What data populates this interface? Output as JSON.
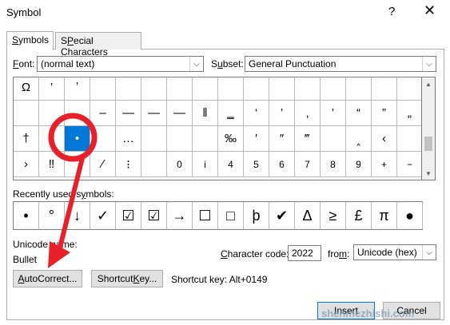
{
  "window": {
    "title": "Symbol",
    "help_glyph": "?",
    "close_glyph": "✕"
  },
  "tabs": [
    {
      "label_pre": "",
      "label_u": "S",
      "label_post": "ymbols",
      "active": true
    },
    {
      "label_pre": "",
      "label_u": "P",
      "label_post": "special Characters",
      "active": false
    }
  ],
  "font": {
    "label_u": "F",
    "label_post": "ont:",
    "value": "(normal text)"
  },
  "subset": {
    "label_u": "u",
    "label_pre": "S",
    "label_post": "bset:",
    "value": "General Punctuation"
  },
  "grid": {
    "rows": [
      [
        "Ω",
        "’",
        "‚",
        "",
        "",
        "",
        "",
        "",
        "",
        "",
        "",
        "",
        "",
        "",
        "",
        ""
      ],
      [
        "",
        "",
        "",
        "–",
        "—",
        "—",
        "―",
        "‖",
        "‗",
        "‘",
        "’",
        "‚",
        "‛",
        "“",
        "”",
        "„"
      ],
      [
        "†",
        "‡",
        "•",
        "‣",
        "․",
        "‥",
        "…",
        "‧",
        "‰",
        "′",
        "″",
        "‴",
        "‵",
        "‸",
        "‹",
        "›"
      ],
      [
        "›",
        "‼",
        "‾",
        "",
        "⁄",
        "⁝",
        "⁰",
        "ⁱ",
        "⁴",
        "⁵",
        "⁶",
        "⁷",
        "⁸",
        "⁹",
        "⁺",
        "⁻"
      ]
    ],
    "display_rows": [
      [
        "Ω",
        "’",
        "ʼ",
        "",
        "",
        "",
        "",
        "",
        "",
        "",
        "",
        "",
        "",
        "",
        "",
        ""
      ],
      [
        "",
        "",
        "",
        "–",
        "—",
        "―",
        "―",
        "‖",
        "‗",
        "‘",
        "’",
        "‚",
        "‛",
        "“",
        "”",
        "„"
      ],
      [
        "†",
        "‡",
        "•",
        "",
        "…",
        "",
        "",
        "",
        "‰",
        "′",
        "″",
        "‴",
        "‵",
        "‸",
        "‹",
        ""
      ],
      [
        "›",
        "‼",
        "‽",
        "⁄",
        "⁝",
        "",
        "⁰",
        "ⁱ",
        "4",
        "5",
        "6",
        "7",
        "8",
        "9",
        "+",
        "−"
      ]
    ],
    "selected": {
      "row": 2,
      "col": 2
    }
  },
  "grid_visible": [
    [
      "Ω",
      "’",
      "ʼ",
      "",
      "",
      "",
      "",
      "",
      "",
      "",
      "",
      "",
      "",
      "",
      "",
      ""
    ],
    [
      "",
      "",
      "",
      "–",
      "—",
      "—",
      "—",
      "‖",
      "‗",
      "‘",
      "’",
      "‚",
      "‛",
      "“",
      "”",
      "„"
    ],
    [
      "†",
      "‡",
      "•",
      "",
      "…",
      "",
      "",
      "",
      "‰",
      "′",
      "″",
      "‴",
      "",
      "‸",
      "‹",
      ""
    ],
    [
      "›",
      "‼",
      "‾",
      "⁄",
      "⁝",
      "",
      "0",
      "i",
      "4",
      "5",
      "6",
      "7",
      "8",
      "9",
      "+",
      "−"
    ]
  ],
  "recent": {
    "label_pre": "Recently used s",
    "label_u": "y",
    "label_post": "mbols:",
    "symbols": [
      "•",
      "°",
      "↓",
      "✓",
      "☑",
      "☑",
      "→",
      "☐",
      "□",
      "þ",
      "✔",
      "Δ",
      "≥",
      "£",
      "π",
      "●"
    ]
  },
  "unicode_name": {
    "label": "Unicode name:",
    "value": "Bullet"
  },
  "char_code": {
    "label_pre": "",
    "label_u": "C",
    "label_post": "haracter code:",
    "value": "2022"
  },
  "from": {
    "label_pre": "fro",
    "label_u": "m",
    "label_post": ":",
    "value": "Unicode (hex)"
  },
  "buttons": {
    "autocorrect": {
      "label_u": "A",
      "label_post": "utoCorrect..."
    },
    "shortcut_key": {
      "label_pre": "Shortcut ",
      "label_u": "K",
      "label_post": "ey..."
    },
    "insert": "Insert",
    "cancel": "Cancel"
  },
  "shortcut_text": "Shortcut key: Alt+0149",
  "watermark": "shenmezhishi.com",
  "colors": {
    "accent": "#0078d7",
    "annotation": "#e8202a"
  }
}
